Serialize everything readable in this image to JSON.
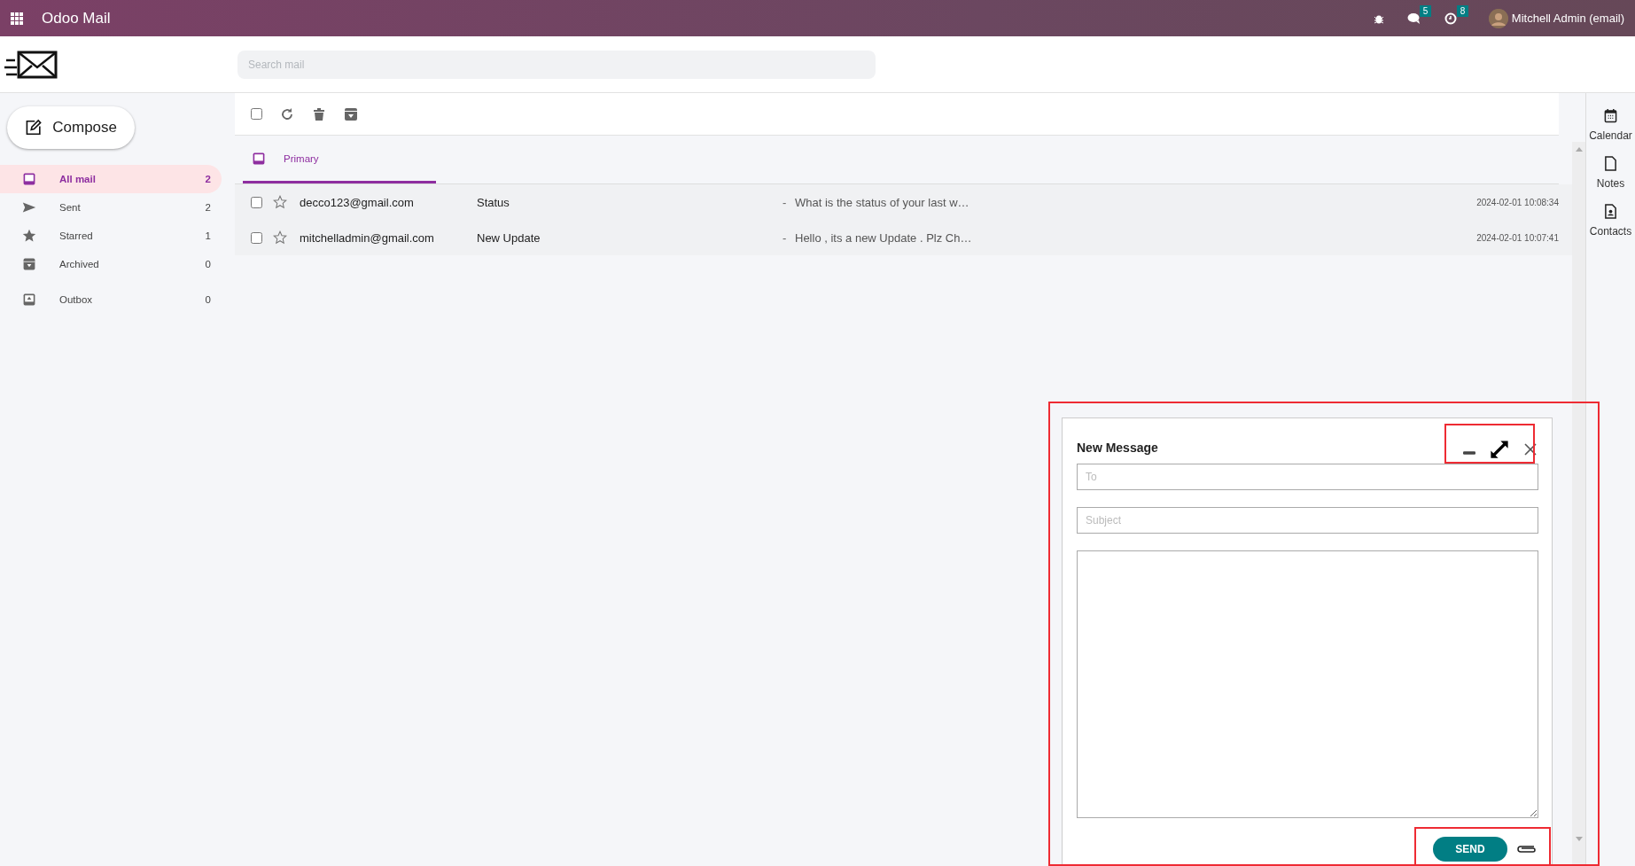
{
  "app_bar": {
    "title": "Odoo Mail",
    "messages_badge": "5",
    "activities_badge": "8",
    "user_name": "Mitchell Admin (email)"
  },
  "search": {
    "placeholder": "Search mail"
  },
  "compose_button": {
    "label": "Compose"
  },
  "folders": [
    {
      "kind": "inbox",
      "label": "All mail",
      "count": "2",
      "selected": true
    },
    {
      "kind": "sent",
      "label": "Sent",
      "count": "2",
      "selected": false
    },
    {
      "kind": "starred",
      "label": "Starred",
      "count": "1",
      "selected": false
    },
    {
      "kind": "archived",
      "label": "Archived",
      "count": "0",
      "selected": false
    },
    {
      "kind": "outbox",
      "label": "Outbox",
      "count": "0",
      "selected": false
    }
  ],
  "toolbar": {
    "select_all_checked": false
  },
  "tabs": [
    {
      "label": "Primary",
      "selected": true
    }
  ],
  "messages": [
    {
      "sender": "decco123@gmail.com",
      "subject": "Status",
      "separator": "-",
      "preview": "What is the status of your last w…",
      "date": "2024-02-01 10:08:34",
      "checked": false,
      "starred": false
    },
    {
      "sender": "mitchelladmin@gmail.com",
      "subject": "New Update",
      "separator": "-",
      "preview": "Hello , its a new Update . Plz Ch…",
      "date": "2024-02-01 10:07:41",
      "checked": false,
      "starred": false
    }
  ],
  "side_panel": [
    {
      "kind": "calendar",
      "label": "Calendar"
    },
    {
      "kind": "notes",
      "label": "Notes"
    },
    {
      "kind": "contacts",
      "label": "Contacts"
    }
  ],
  "compose": {
    "title": "New Message",
    "fields": [
      {
        "placeholder": "To"
      },
      {
        "placeholder": "Subject"
      }
    ],
    "send_label": "SEND"
  }
}
